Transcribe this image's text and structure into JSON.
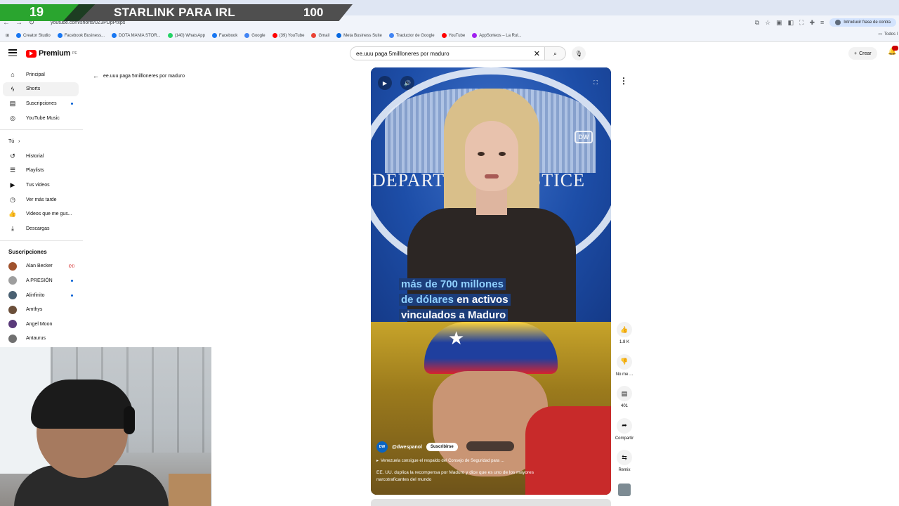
{
  "overlay": {
    "left_number": "19",
    "title": "STARLINK PARA IRL",
    "right_number": "100"
  },
  "browser": {
    "url": "youtube.com/shorts/0Z3PDpPtxps",
    "profile_chip": "Introducir frase de contra",
    "bookmarks": [
      {
        "label": "Creator Studio",
        "color": "#1877f2"
      },
      {
        "label": "Facebook Business...",
        "color": "#1877f2"
      },
      {
        "label": "DOTA MANIA STOR...",
        "color": "#1877f2"
      },
      {
        "label": "(140) WhatsApp",
        "color": "#25d366"
      },
      {
        "label": "Facebook",
        "color": "#1877f2"
      },
      {
        "label": "Google",
        "color": "#4285f4"
      },
      {
        "label": "(39) YouTube",
        "color": "#ff0000"
      },
      {
        "label": "Gmail",
        "color": "#ea4335"
      },
      {
        "label": "Meta Business Suite",
        "color": "#0668e1"
      },
      {
        "label": "Traductor de Google",
        "color": "#4285f4"
      },
      {
        "label": "YouTube",
        "color": "#ff0000"
      },
      {
        "label": "AppSorteos – La Rul...",
        "color": "#a020f0"
      }
    ],
    "all_bookmarks": "Todos l"
  },
  "masthead": {
    "logo_text": "Premium",
    "logo_sup": "PE",
    "search_value": "ee.uuu paga 5millloneres por maduro",
    "create_label": "Crear"
  },
  "sidebar": {
    "main_items": [
      {
        "label": "Principal",
        "icon": "home-icon",
        "glyph": "⌂"
      },
      {
        "label": "Shorts",
        "icon": "shorts-icon",
        "glyph": "ϟ"
      },
      {
        "label": "Suscripciones",
        "icon": "subscriptions-icon",
        "glyph": "▤"
      },
      {
        "label": "YouTube Music",
        "icon": "music-icon",
        "glyph": "◎"
      }
    ],
    "you_heading": "Tú",
    "you_items": [
      {
        "label": "Historial",
        "icon": "history-icon",
        "glyph": "↺"
      },
      {
        "label": "Playlists",
        "icon": "playlists-icon",
        "glyph": "☰"
      },
      {
        "label": "Tus videos",
        "icon": "your-videos-icon",
        "glyph": "▶"
      },
      {
        "label": "Ver más tarde",
        "icon": "watch-later-icon",
        "glyph": "◷"
      },
      {
        "label": "Videos que me gus...",
        "icon": "liked-icon",
        "glyph": "👍"
      },
      {
        "label": "Descargas",
        "icon": "downloads-icon",
        "glyph": "⤓"
      }
    ],
    "subs_heading": "Suscripciones",
    "subscriptions": [
      {
        "label": "Alan Becker",
        "color": "#a0522d",
        "badge": "((•))"
      },
      {
        "label": "A PRESIÓN",
        "color": "#9e9e9e",
        "badge": ""
      },
      {
        "label": "Alinfinito",
        "color": "#4a6072",
        "badge": ""
      },
      {
        "label": "Amthys",
        "color": "#6b4f3a",
        "badge": ""
      },
      {
        "label": "Angel Moon",
        "color": "#5a3a7a",
        "badge": ""
      },
      {
        "label": "Antaurus",
        "color": "#707070",
        "badge": ""
      }
    ]
  },
  "back_link": {
    "label": "ee.uuu paga 5millloneres por maduro"
  },
  "video": {
    "seal_left": "DEPART",
    "seal_right": "USTICE",
    "watermark": "DW",
    "caption_line1": "más de 700 millones",
    "caption_line2a": "de dólares",
    "caption_line2b": " en activos",
    "caption_line3": "vinculados a Maduro",
    "channel_badge": "DW",
    "channel": "@dwespanol",
    "subscribe": "Suscribirse",
    "linked": "Venezuela consigue el respaldo del Consejo de Seguridad para ...",
    "description": "EE. UU. duplica la recompensa por Maduro y dice que es uno de los mayores narcotraficantes del mundo"
  },
  "rail": {
    "like_count": "1.8 K",
    "dislike_label": "No me ...",
    "comments_count": "401",
    "share_label": "Compartir",
    "remix_label": "Remix"
  },
  "colors": {
    "accent_red": "#ff0000",
    "overlay_green": "#2aa52f",
    "caption_blue": "#8fd0ff"
  }
}
